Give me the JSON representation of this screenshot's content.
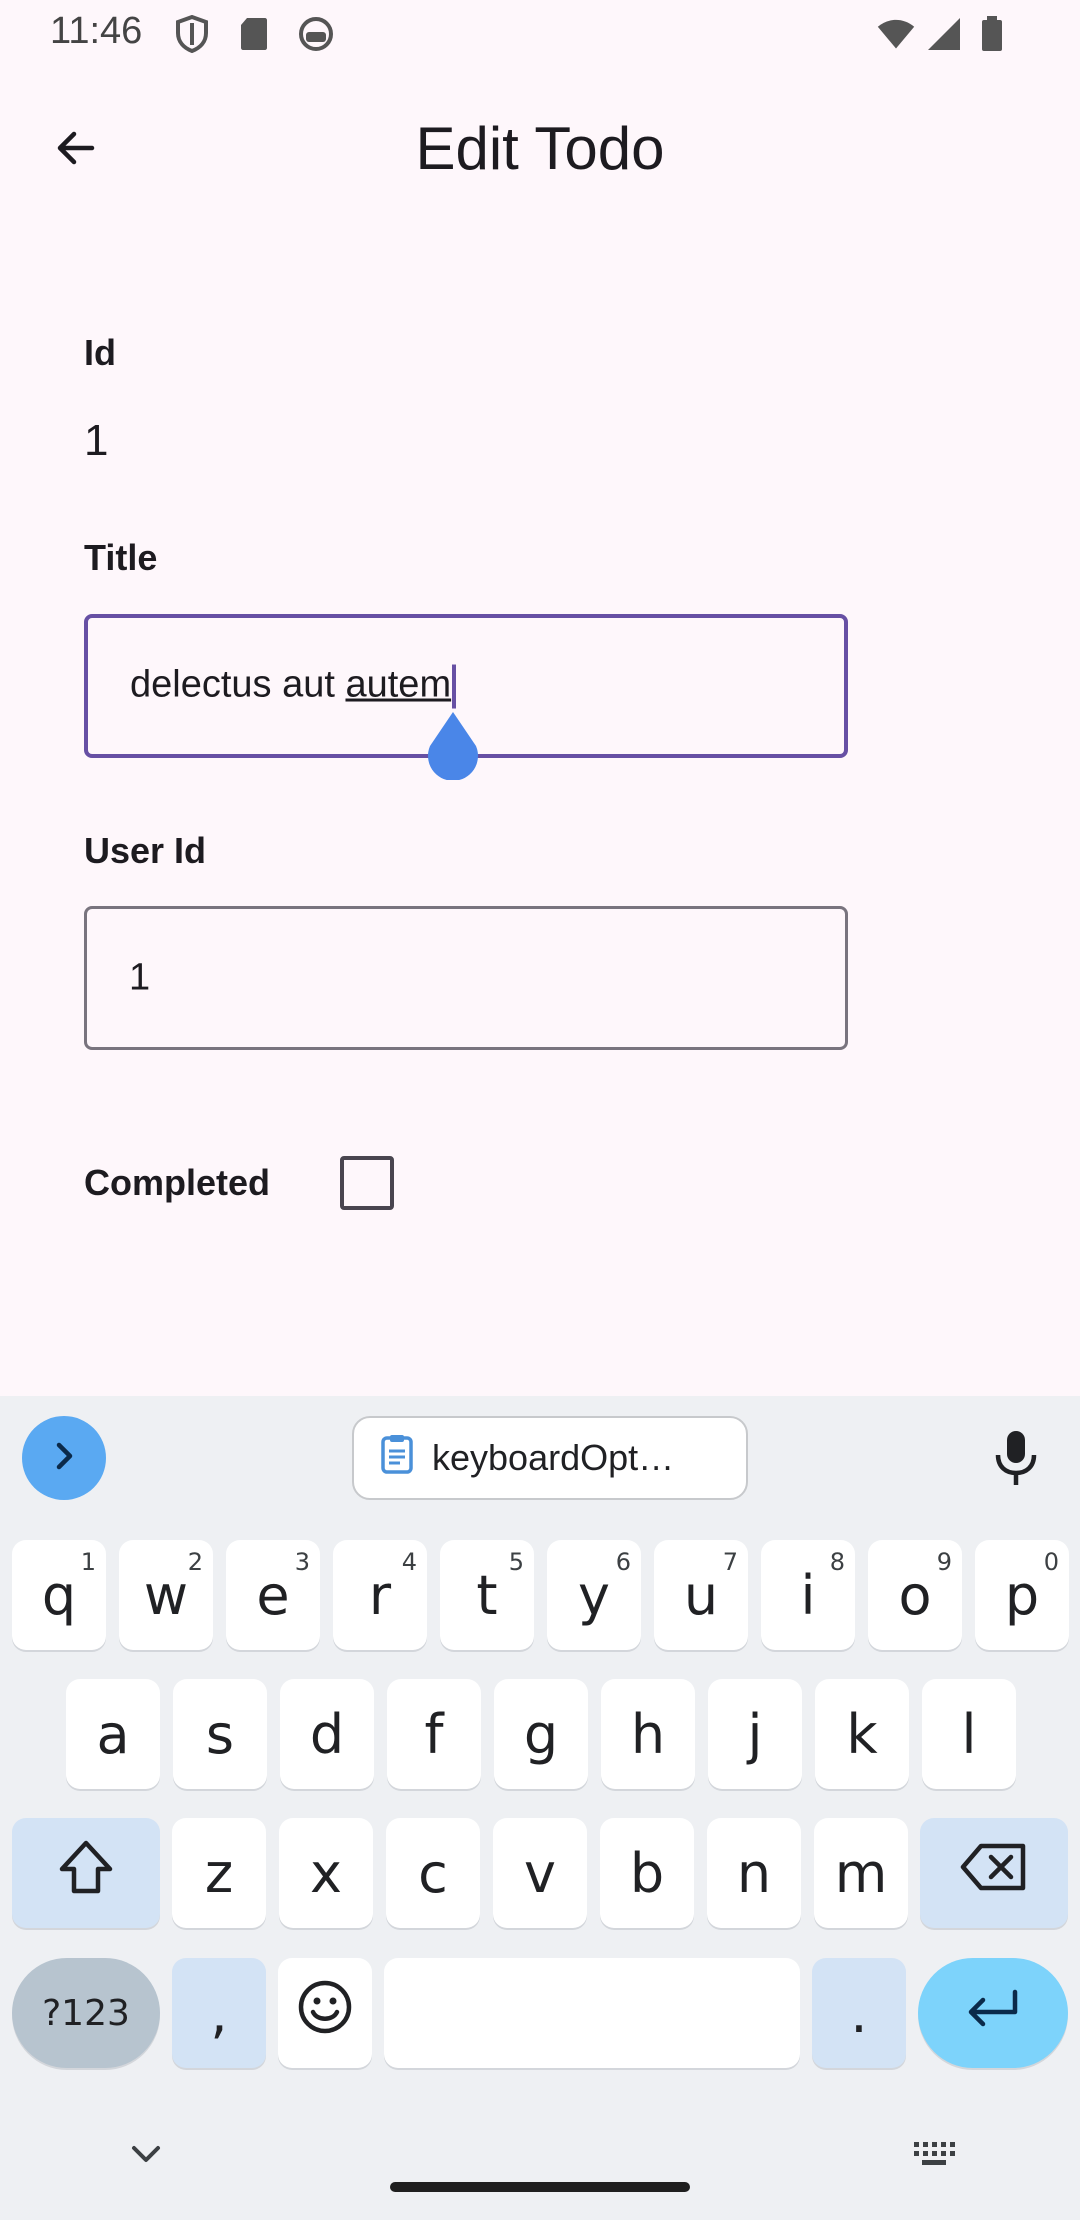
{
  "status_bar": {
    "time": "11:46",
    "icons": [
      "shield-icon",
      "sd-card-icon",
      "android-debug-icon",
      "wifi-icon",
      "signal-icon",
      "battery-icon"
    ]
  },
  "app_bar": {
    "title": "Edit Todo",
    "back_icon": "arrow-back-icon"
  },
  "form": {
    "id_label": "Id",
    "id_value": "1",
    "title_label": "Title",
    "title_value_plain": "delectus aut ",
    "title_value_underlined": "autem",
    "user_id_label": "User Id",
    "user_id_value": "1",
    "completed_label": "Completed",
    "completed_checked": false
  },
  "keyboard": {
    "clipboard_suggestion": "keyboardOpt…",
    "row1": [
      {
        "key": "q",
        "sup": "1"
      },
      {
        "key": "w",
        "sup": "2"
      },
      {
        "key": "e",
        "sup": "3"
      },
      {
        "key": "r",
        "sup": "4"
      },
      {
        "key": "t",
        "sup": "5"
      },
      {
        "key": "y",
        "sup": "6"
      },
      {
        "key": "u",
        "sup": "7"
      },
      {
        "key": "i",
        "sup": "8"
      },
      {
        "key": "o",
        "sup": "9"
      },
      {
        "key": "p",
        "sup": "0"
      }
    ],
    "row2": [
      "a",
      "s",
      "d",
      "f",
      "g",
      "h",
      "j",
      "k",
      "l"
    ],
    "row3": [
      "z",
      "x",
      "c",
      "v",
      "b",
      "n",
      "m"
    ],
    "symbols_key": "?123",
    "comma_key": ",",
    "period_key": ".",
    "colors": {
      "accent": "#6750a4",
      "enter": "#7dd3fb",
      "expand": "#5aa9f2"
    }
  }
}
